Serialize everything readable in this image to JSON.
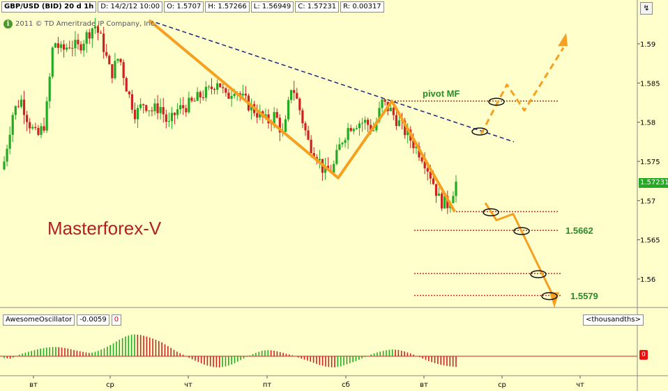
{
  "header": {
    "symbol": "GBP/USD (BID) 20 d 1h",
    "date": "D: 14/2/12 10:00",
    "open": "O: 1.5707",
    "high": "H: 1.57266",
    "low": "L: 1.56949",
    "close": "C: 1.57231",
    "range": "R: 0.00317"
  },
  "copyright": "2011 © TD Ameritrade IP Company, Inc.",
  "watermark": "Masterforex-V",
  "annotations": {
    "pivot_label": "pivot MF",
    "level1": "1.5662",
    "level2": "1.5579"
  },
  "price_axis": {
    "ticks": [
      "1.59",
      "1.585",
      "1.58",
      "1.575",
      "1.57",
      "1.565",
      "1.56"
    ],
    "current_price": "1.57231"
  },
  "oscillator": {
    "name": "AwesomeOscillator",
    "value": "-0.0059",
    "param": "0",
    "unit": "<thousandths>",
    "zero_label": "0"
  },
  "x_axis": {
    "ticks": [
      "вт",
      "ср",
      "чт",
      "пт",
      "сб",
      "вт",
      "ср",
      "чт"
    ]
  },
  "colors": {
    "background": "#ffffcc",
    "bull": "#22aa22",
    "bear": "#cc2222",
    "pattern": "#f5a020",
    "trendline": "#1a237e",
    "levels": "#c42d2d",
    "watermark": "#b02020",
    "label_green": "#2a8a2a"
  },
  "chart_data": {
    "type": "candlestick",
    "instrument": "GBP/USD (BID)",
    "timeframe": "1h",
    "ylim": [
      1.5563,
      1.5933
    ],
    "ohlc_path": [
      1.575,
      1.581,
      1.583,
      1.58,
      1.578,
      1.58,
      1.5905,
      1.589,
      1.59,
      1.5895,
      1.591,
      1.5925,
      1.59,
      1.586,
      1.5885,
      1.584,
      1.581,
      1.5825,
      1.5815,
      1.582,
      1.5795,
      1.5815,
      1.582,
      1.5825,
      1.5835,
      1.584,
      1.5855,
      1.583,
      1.5845,
      1.583,
      1.582,
      1.581,
      1.58,
      1.581,
      1.578,
      1.585,
      1.5815,
      1.5775,
      1.576,
      1.5735,
      1.574,
      1.5775,
      1.5795,
      1.58,
      1.58,
      1.579,
      1.5825,
      1.5815,
      1.58,
      1.5785,
      1.577,
      1.5755,
      1.573,
      1.57,
      1.5695,
      1.5723
    ],
    "trendline": [
      {
        "x": 214,
        "y": 1.593
      },
      {
        "x": 737,
        "y": 1.5775
      }
    ],
    "levels": [
      1.5827,
      1.5686,
      1.5662,
      1.5607,
      1.5579
    ],
    "oscillator_values": [
      -0.03,
      -0.04,
      0.02,
      0.06,
      0.09,
      0.12,
      0.14,
      0.15,
      0.14,
      0.12,
      0.09,
      0.07,
      0.05,
      0.08,
      0.13,
      0.19,
      0.26,
      0.32,
      0.35,
      0.34,
      0.31,
      0.27,
      0.22,
      0.15,
      0.08,
      0.02,
      -0.04,
      -0.09,
      -0.14,
      -0.17,
      -0.18,
      -0.16,
      -0.12,
      -0.06,
      0.0,
      0.05,
      0.09,
      0.1,
      0.08,
      0.05,
      0.02,
      -0.02,
      -0.06,
      -0.1,
      -0.14,
      -0.17,
      -0.18,
      -0.16,
      -0.12,
      -0.08,
      -0.03,
      0.02,
      0.06,
      0.09,
      0.11,
      0.1,
      0.07,
      0.03,
      -0.02,
      -0.07,
      -0.11,
      -0.14,
      -0.16,
      -0.17
    ]
  }
}
